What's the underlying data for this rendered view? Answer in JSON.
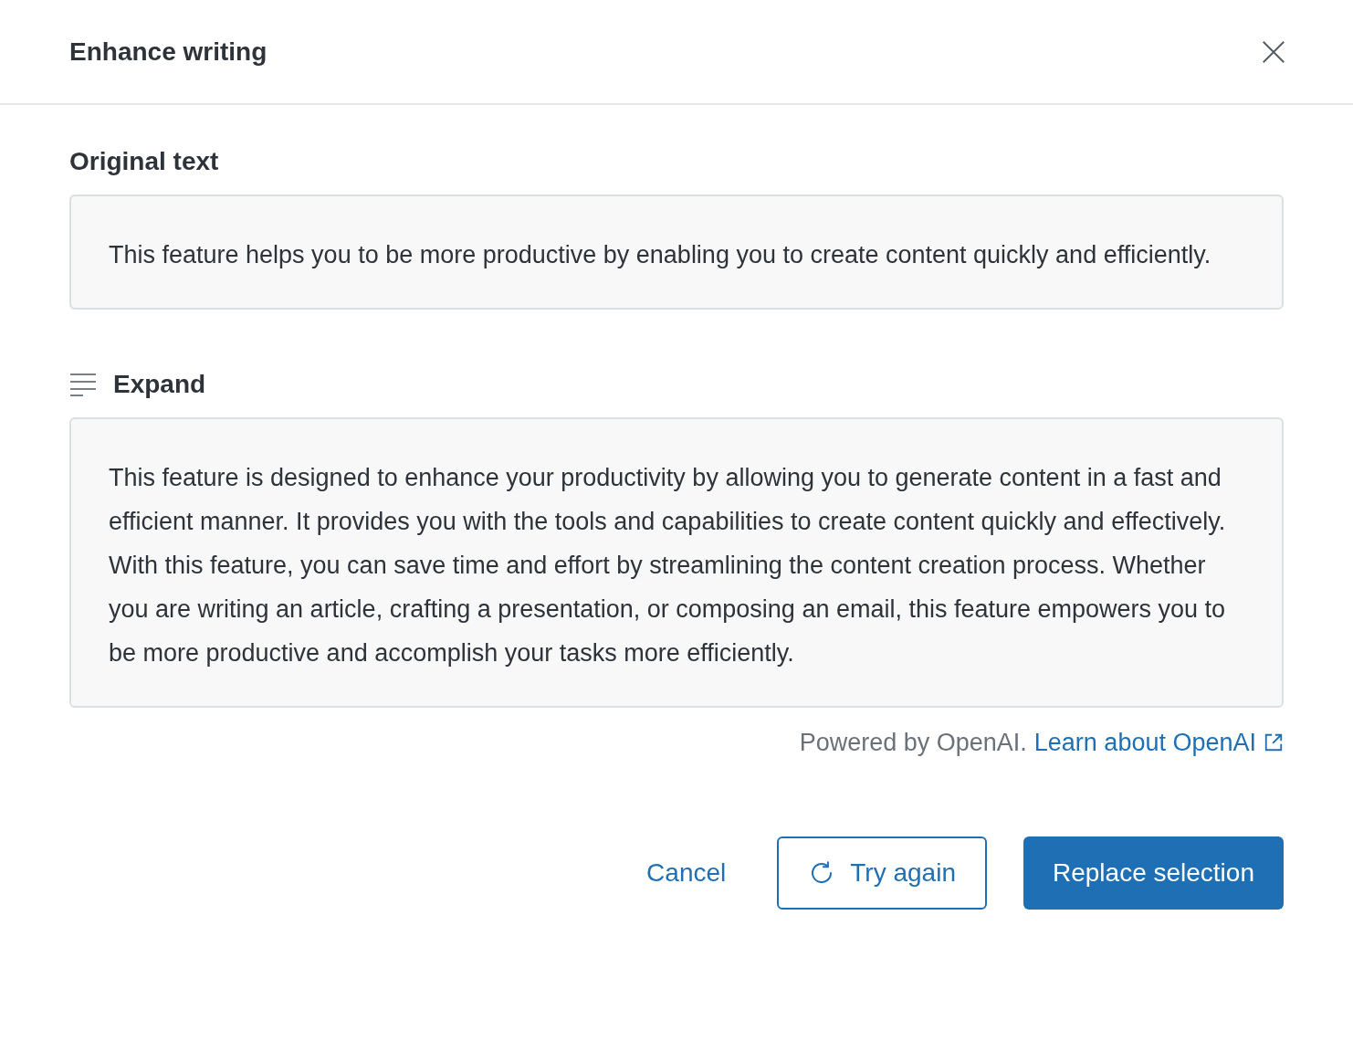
{
  "dialog": {
    "title": "Enhance writing"
  },
  "original": {
    "label": "Original text",
    "text": "This feature helps you to be more productive by enabling you to create content quickly and efficiently."
  },
  "result": {
    "label": "Expand",
    "text": "This feature is designed to enhance your productivity by allowing you to generate content in a fast and efficient manner. It provides you with the tools and capabilities to create content quickly and effectively. With this feature, you can save time and effort by streamlining the content creation process. Whether you are writing an article, crafting a presentation, or composing an email, this feature empowers you to be more productive and accomplish your tasks more efficiently."
  },
  "footer_note": {
    "text": "Powered by OpenAI.",
    "link": "Learn about OpenAI"
  },
  "buttons": [
    {
      "kind": "link",
      "label": "Cancel"
    },
    {
      "kind": "outline",
      "label": "Try again"
    },
    {
      "kind": "primary",
      "label": "Replace selection"
    }
  ]
}
